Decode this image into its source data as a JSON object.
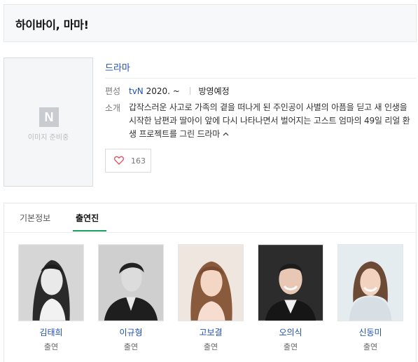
{
  "header": {
    "title": "하이바이, 마마!"
  },
  "poster": {
    "placeholder_logo": "N",
    "placeholder_text": "이미지 준비중"
  },
  "info": {
    "genre": "드라마",
    "schedule_label": "편성",
    "channel": "tvN",
    "year": "2020. ~",
    "status": "방영예정",
    "synopsis_label": "소개",
    "synopsis": "갑작스러운 사고로 가족의 곁을 떠나게 된 주인공이 사별의 아픔을 딛고 새 인생을 시작한 남편과 딸아이 앞에 다시 나타나면서 벌어지는 고스트 엄마의 49일 리얼 환생 프로젝트를 그린 드라마",
    "expand_icon": "chevron-up-icon"
  },
  "like": {
    "icon": "heart-icon",
    "count": "163"
  },
  "tabs": [
    {
      "label": "기본정보",
      "active": false
    },
    {
      "label": "출연진",
      "active": true
    }
  ],
  "cast": [
    {
      "name": "김태희",
      "role": "출연"
    },
    {
      "name": "이규형",
      "role": "출연"
    },
    {
      "name": "고보결",
      "role": "출연"
    },
    {
      "name": "오의식",
      "role": "출연"
    },
    {
      "name": "신동미",
      "role": "출연"
    }
  ],
  "colors": {
    "link": "#1e4fb8",
    "tab_active_underline": "#19a05c",
    "heart": "#e04a5a"
  }
}
